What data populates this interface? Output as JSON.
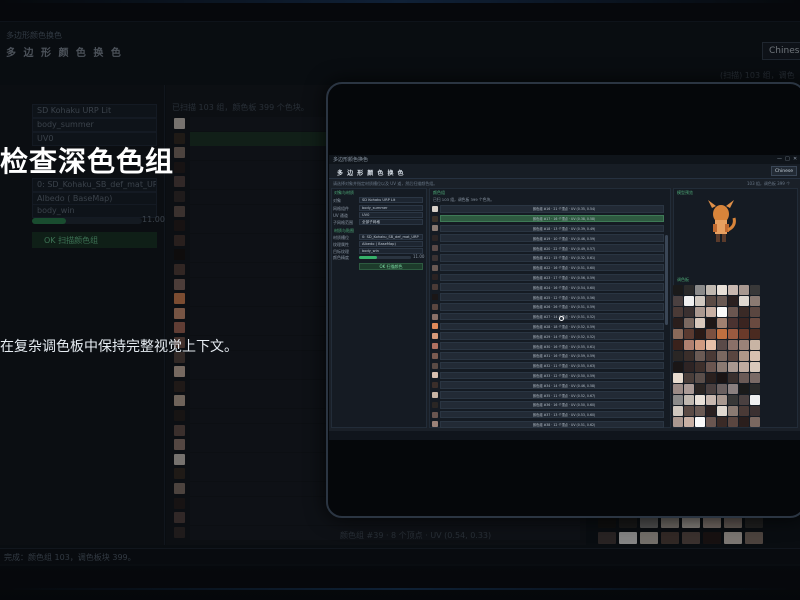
{
  "background": {
    "window_title": "多边形颜色换色",
    "header": "多 边 形 颜 色 换 色",
    "language": "Chinese",
    "sub_right": "(扫描) 103 组，调色板 399 个色块",
    "labels": [
      "件",
      "件",
      "",
      "",
      "件",
      "件",
      "件",
      "度"
    ],
    "fields": [
      "SD Kohaku URP Lit",
      "body_summer",
      "UV0",
      "0: SD_Kohaku_SB_def_mat_URP",
      "Albedo ( BaseMap)",
      "body_win"
    ],
    "slider_value": "11.00",
    "ok_label": "OK 扫描颜色组",
    "list_header": "已扫描 103 组，颜色板 399 个色块。",
    "footer_row": "颜色组 #39 · 8 个顶点 · UV (0.54, 0.33)",
    "status": "完成：颜色组 103，调色板块 399。"
  },
  "overlay": {
    "title": "检查深色色组",
    "subtitle": "在复杂调色板中保持完整视觉上下文。"
  },
  "screen": {
    "titlebar": "多边形颜色换色",
    "header": "多 边 形 颜 色 换 色",
    "language": "Chinese",
    "desc": "请选择对象并指定材质槽位以及 UV 道，然后扫描颜色组。",
    "desc_right": "103 组，调色板 399 个",
    "section_object": "对象与材质",
    "section_texture": "材质与贴图",
    "labels": [
      "对象",
      "网格组件",
      "UV 通道",
      "子网格范围",
      "材质槽位",
      "纹理属性",
      "目标纹理",
      "颜色精度"
    ],
    "fields": [
      "SD Kohaku URP Lit",
      "body_summer",
      "UV0",
      "全部子网格",
      "0: SD_Kohaku_SB_def_mat_URP",
      "Albedo ( BaseMap)",
      "body_win"
    ],
    "slider_value": "11.00",
    "ok_label": "OK 扫描颜色",
    "mid_header": "颜色组",
    "mid_info": "已扫 103 组，调色板 399 个色块。",
    "rows": [
      "颜色组 #16 · 21 个顶点 · UV (0.35, 0.54)",
      "颜色组 #17 · 16 个顶点 · UV (0.38, 0.58)",
      "颜色组 #18 · 13 个顶点 · UV (0.39, 0.49)",
      "颜色组 #19 · 10 个顶点 · UV (0.46, 0.59)",
      "颜色组 #20 · 22 个顶点 · UV (0.49, 0.57)",
      "颜色组 #21 · 15 个顶点 · UV (0.32, 0.61)",
      "颜色组 #22 · 16 个顶点 · UV (0.51, 0.60)",
      "颜色组 #23 · 17 个顶点 · UV (0.56, 0.59)",
      "颜色组 #24 · 16 个顶点 · UV (0.54, 0.60)",
      "颜色组 #25 · 12 个顶点 · UV (0.55, 0.56)",
      "颜色组 #26 · 26 个顶点 · UV (0.51, 0.59)",
      "颜色组 #27 · 14 个顶点 · UV (0.51, 0.52)",
      "颜色组 #28 · 18 个顶点 · UV (0.52, 0.59)",
      "颜色组 #29 · 14 个顶点 · UV (0.52, 0.52)",
      "颜色组 #30 · 16 个顶点 · UV (0.55, 0.61)",
      "颜色组 #31 · 16 个顶点 · UV (0.59, 0.59)",
      "颜色组 #32 · 11 个顶点 · UV (0.55, 0.63)",
      "颜色组 #33 · 12 个顶点 · UV (0.50, 0.59)",
      "颜色组 #34 · 14 个顶点 · UV (0.46, 0.58)",
      "颜色组 #35 · 11 个顶点 · UV (0.52, 0.67)",
      "颜色组 #36 · 16 个顶点 · UV (0.50, 0.60)",
      "颜色组 #37 · 13 个顶点 · UV (0.53, 0.60)",
      "颜色组 #38 · 12 个顶点 · UV (0.51, 0.62)"
    ],
    "row_colors": [
      "#d8d0c8",
      "#3a3028",
      "#8a7a72",
      "#2a2424",
      "#5a4a48",
      "#3a3232",
      "#6a5a54",
      "#2a2222",
      "#4a3a36",
      "#1a1616",
      "#5a4640",
      "#8a7068",
      "#e08a5a",
      "#d89a7a",
      "#b07060",
      "#7a5a50",
      "#5a4a44",
      "#d8c0b0",
      "#3a2e2a",
      "#c8b4a4",
      "#2a2624",
      "#6a5650",
      "#9a8278"
    ],
    "selected_row": 1,
    "right_header_preview": "模型预览",
    "right_header_palette": "调色板",
    "palette": [
      "#1a1a1a",
      "#2a2a2a",
      "#8a8a8a",
      "#c0b8b0",
      "#e8e0d8",
      "#c8b8b0",
      "#a89890",
      "#383838",
      "#4a4040",
      "#f0f0f0",
      "#d0c8c0",
      "#5a4a44",
      "#6a5a54",
      "#2a2020",
      "#e0d8d0",
      "#8a7a72",
      "#4a3a36",
      "#3a3030",
      "#aa9890",
      "#c8b0a4",
      "#fafafa",
      "#6a5650",
      "#3a2a26",
      "#5a4640",
      "#2a1e1c",
      "#7a6860",
      "#d8c8bc",
      "#1e1616",
      "#a08070",
      "#4a3230",
      "#3a2420",
      "#6a4a40",
      "#8a6a5a",
      "#5a3a30",
      "#2a1a16",
      "#7a5040",
      "#c07040",
      "#9a5a40",
      "#6a3a2a",
      "#4a2a20",
      "#3a221c",
      "#b08070",
      "#d09a80",
      "#e8c0a8",
      "#5a4a48",
      "#8a7068",
      "#9a8278",
      "#c8b4a4",
      "#2a2624",
      "#3a2e2a",
      "#6a5a54",
      "#4a3a36",
      "#7a6860",
      "#5a4640",
      "#b09888",
      "#d8c0b0",
      "#1a1616",
      "#2e2424",
      "#3e302c",
      "#6a5650",
      "#8a7a72",
      "#a89890",
      "#c0aca0",
      "#d8c8bc",
      "#e8dcd0",
      "#4a3e3a",
      "#5a4e4a",
      "#2a201e",
      "#1a1414",
      "#3a302e",
      "#6a5a56",
      "#7a6a66",
      "#9a8a86",
      "#aa9a96",
      "#2a2422",
      "#4a4040",
      "#6a6060",
      "#8a8080"
    ]
  }
}
